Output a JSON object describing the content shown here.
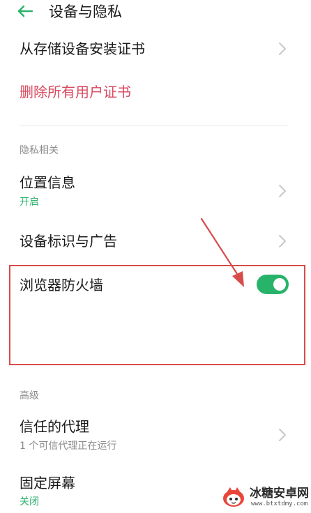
{
  "header": {
    "title": "设备与隐私",
    "back_icon": "arrow-left-icon"
  },
  "rows": {
    "install_cert": {
      "title": "从存储设备安装证书"
    },
    "delete_cert": {
      "title": "删除所有用户证书"
    },
    "location": {
      "title": "位置信息",
      "status": "开启"
    },
    "device_id_ads": {
      "title": "设备标识与广告"
    },
    "browser_firewall": {
      "title": "浏览器防火墙",
      "toggle_on": true
    },
    "trust_agent": {
      "title": "信任的代理",
      "subtitle": "1 个可信代理正在运行"
    },
    "screen_pinning": {
      "title": "固定屏幕",
      "status": "关闭"
    }
  },
  "sections": {
    "privacy": "隐私相关",
    "advanced": "高级"
  },
  "watermark": {
    "title": "冰糖安卓网",
    "url": "www.btxtdmy.com"
  },
  "colors": {
    "accent_green": "#27b46a",
    "danger_red": "#d9485f",
    "annotation_red": "#d94b4b",
    "text_primary": "#1a1a1a",
    "text_secondary": "#8c8c8c"
  }
}
